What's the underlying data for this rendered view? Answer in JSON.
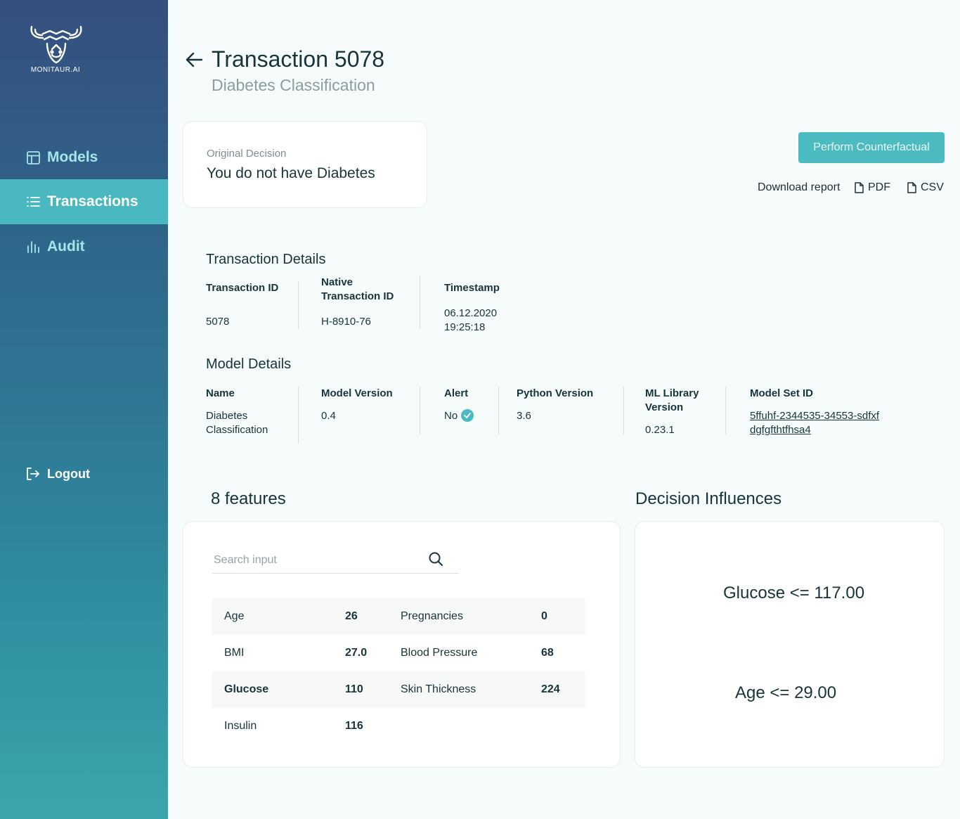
{
  "brand": {
    "name": "MONITAUR.AI"
  },
  "nav": {
    "models": "Models",
    "transactions": "Transactions",
    "audit": "Audit",
    "logout": "Logout"
  },
  "header": {
    "title": "Transaction 5078",
    "subtitle": "Diabetes Classification"
  },
  "decision": {
    "label": "Original Decision",
    "value": "You do not have Diabetes"
  },
  "actions": {
    "counterfactual": "Perform Counterfactual",
    "download_label": "Download report",
    "pdf": "PDF",
    "csv": "CSV"
  },
  "transaction_details": {
    "title": "Transaction Details",
    "transaction_id_label": "Transaction ID",
    "transaction_id": "5078",
    "native_id_label_1": "Native",
    "native_id_label_2": "Transaction ID",
    "native_id": "H-8910-76",
    "timestamp_label": "Timestamp",
    "timestamp_date": "06.12.2020",
    "timestamp_time": "19:25:18"
  },
  "model_details": {
    "title": "Model Details",
    "name_label": "Name",
    "name_1": "Diabetes",
    "name_2": "Classification",
    "version_label": "Model Version",
    "version": "0.4",
    "alert_label": "Alert",
    "alert": "No",
    "python_label": "Python Version",
    "python": "3.6",
    "ml_label_1": "ML Library",
    "ml_label_2": "Version",
    "ml_version": "0.23.1",
    "set_id_label": "Model Set ID",
    "set_id_1": "5ffuhf-2344535-34553-sdfxf",
    "set_id_2": "dgfgfthtfhsa4"
  },
  "features": {
    "title": "8 features",
    "search_placeholder": "Search input",
    "rows": [
      {
        "n1": "Age",
        "v1": "26",
        "n2": "Pregnancies",
        "v2": "0"
      },
      {
        "n1": "BMI",
        "v1": "27.0",
        "n2": "Blood Pressure",
        "v2": "68"
      },
      {
        "n1": "Glucose",
        "v1": "110",
        "n2": "Skin Thickness",
        "v2": "224"
      },
      {
        "n1": "Insulin",
        "v1": "116",
        "n2": "",
        "v2": ""
      }
    ]
  },
  "influences": {
    "title": "Decision Influences",
    "items": [
      "Glucose <= 117.00",
      "Age <= 29.00"
    ]
  },
  "colors": {
    "accent": "#4bbac1",
    "sidebar_top": "#344f7e",
    "sidebar_bottom": "#3aa6ab"
  }
}
